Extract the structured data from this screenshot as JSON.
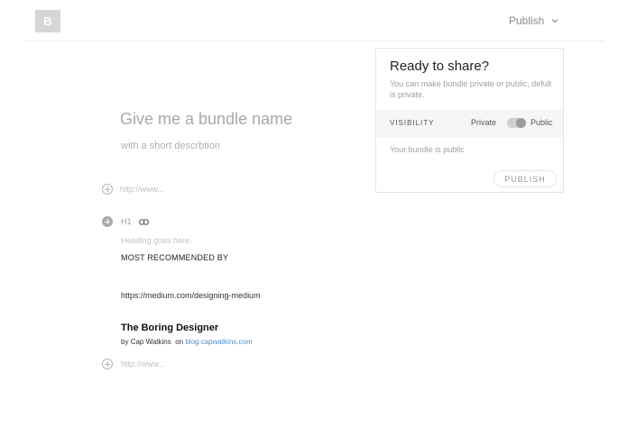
{
  "header": {
    "logo_letter": "B",
    "publish_menu_label": "Publish"
  },
  "share_panel": {
    "title": "Ready to share?",
    "description": "You can make bundle private or public, defult is private.",
    "visibility_label": "VISIBILITY",
    "private_label": "Private",
    "public_label": "Public",
    "visibility_selected": "Public",
    "status_text": "Your bundle is public",
    "publish_button_label": "PUBLISH"
  },
  "bundle": {
    "name_placeholder": "Give me a bundle name",
    "description_placeholder": "with a short descrbtion"
  },
  "editor": {
    "url_placeholder_top": "http://www...",
    "url_placeholder_bottom": "http://www...",
    "h1_label": "H1",
    "heading_placeholder": "Heading goes here.",
    "section_heading": "MOST RECOMMENDED BY",
    "link_url": "https://medium.com/designing-medium",
    "card": {
      "title": "The Boring Designer",
      "by_prefix": "by",
      "author": "Cap Watkins",
      "on_word": "on",
      "source": "blog.capwatkins.com"
    }
  },
  "colors": {
    "accent_link": "#4a8fd0",
    "panel_border": "#e4e4e4",
    "logo_bg": "#d6d6d6"
  },
  "icons": [
    "chevron-down-icon",
    "plus-circle-icon",
    "link-icon"
  ]
}
